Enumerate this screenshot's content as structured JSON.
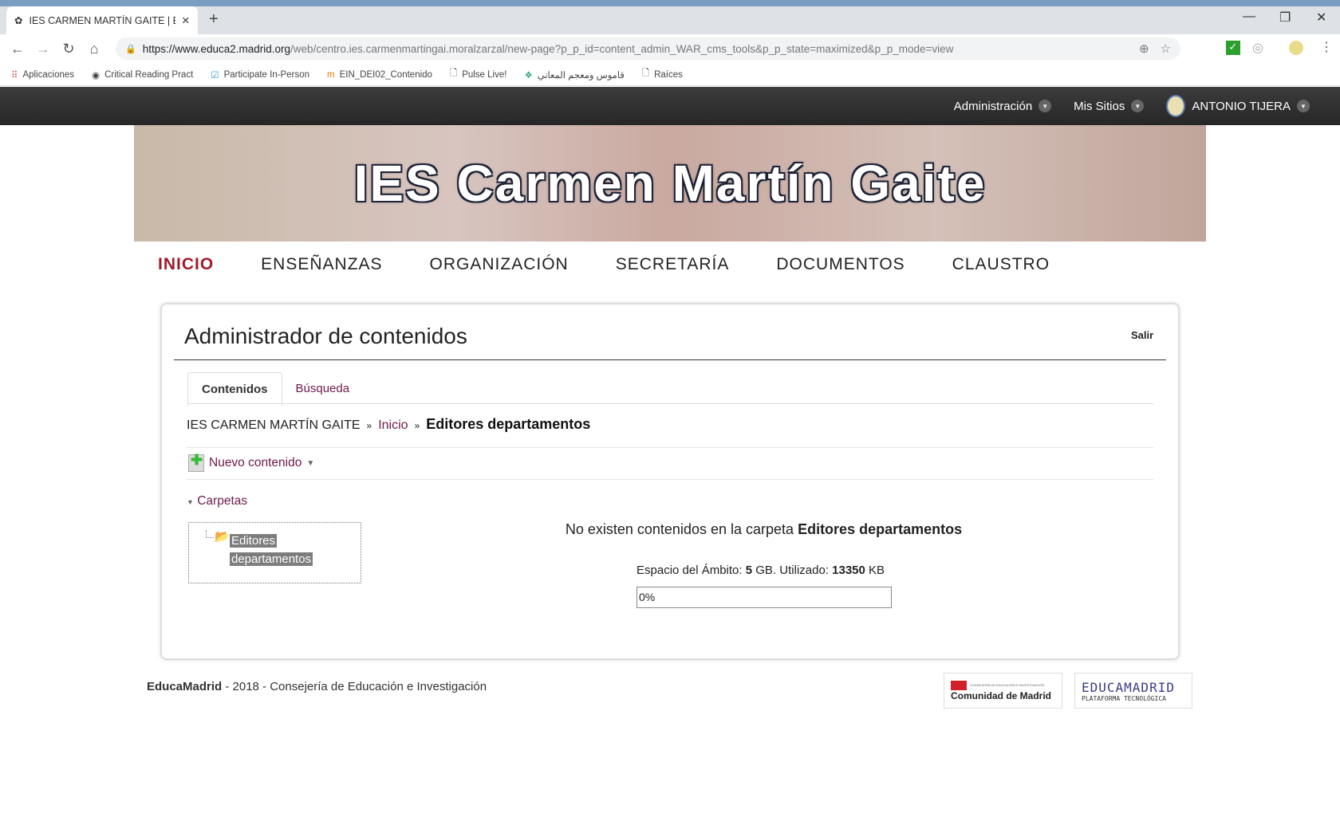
{
  "browser": {
    "tab_title": "IES CARMEN MARTÍN GAITE | Ed",
    "url_host": "https://www.educa2.madrid.org",
    "url_path": "/web/centro.ies.carmenmartingai.moralzarzal/new-page?p_p_id=content_admin_WAR_cms_tools&p_p_state=maximized&p_p_mode=view",
    "bookmarks": [
      "Aplicaciones",
      "Critical Reading Pract",
      "Participate In-Person",
      "EIN_DEI02_Contenido",
      "Pulse Live!",
      "قاموس ومعجم المعاني",
      "Raíces"
    ]
  },
  "adminbar": {
    "items": [
      "Administración",
      "Mis Sitios",
      "ANTONIO TIJERA"
    ]
  },
  "banner": {
    "title": "IES Carmen Martín Gaite"
  },
  "nav": [
    "INICIO",
    "ENSEÑANZAS",
    "ORGANIZACIÓN",
    "SECRETARÍA",
    "DOCUMENTOS",
    "CLAUSTRO"
  ],
  "portlet": {
    "title": "Administrador de contenidos",
    "exit": "Salir",
    "tabs": [
      "Contenidos",
      "Búsqueda"
    ],
    "breadcrumb": [
      "IES CARMEN MARTÍN GAITE",
      "Inicio",
      "Editores departamentos"
    ],
    "new_content": "Nuevo contenido",
    "folders_label": "Carpetas",
    "folder_line1": "Editores",
    "folder_line2": "departamentos",
    "empty_msg": "No existen contenidos en la carpeta",
    "empty_folder": "Editores departamentos",
    "space_label": "Espacio del Ámbito:",
    "space_value": "5",
    "space_unit": "GB. Utilizado:",
    "used_value": "13350",
    "used_unit": "KB",
    "usage_percent_label": "0%",
    "usage_percent": 0
  },
  "footer": {
    "brand": "EducaMadrid",
    "text": " - 2018 - Consejería de Educación e Investigación",
    "logo1_small": "CONSEJERÍA DE EDUCACIÓN E INVESTIGACIÓN",
    "logo1": "Comunidad de Madrid",
    "logo2": "EDUCAMADRID",
    "logo2_sub": "PLATAFORMA TECNOLÓGICA"
  }
}
